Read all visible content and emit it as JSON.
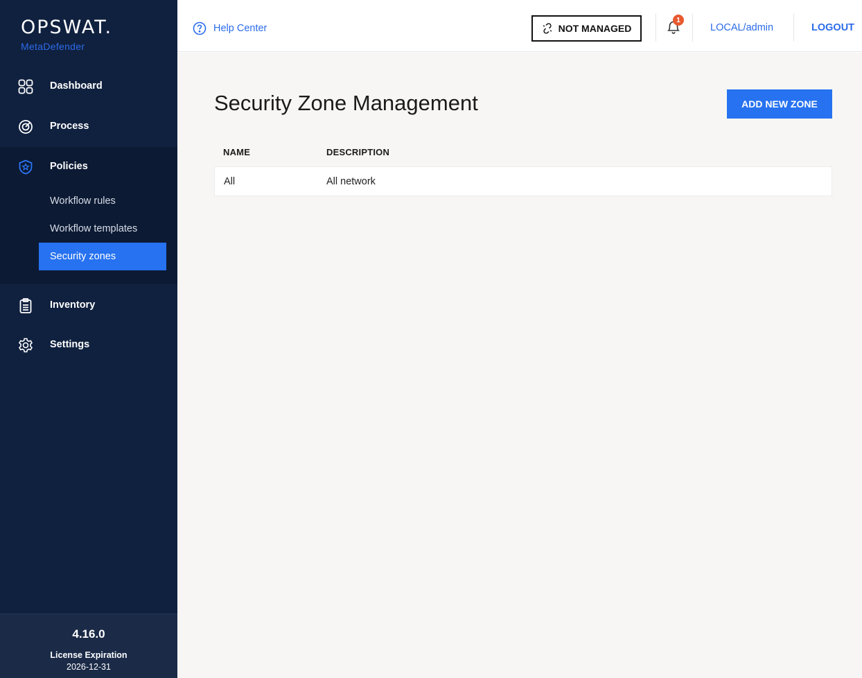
{
  "brand": {
    "name": "OPSWAT.",
    "product": "MetaDefender"
  },
  "sidebar": {
    "items": [
      {
        "label": "Dashboard",
        "icon": "dashboard-grid-icon"
      },
      {
        "label": "Process",
        "icon": "process-target-icon"
      },
      {
        "label": "Policies",
        "icon": "shield-star-icon"
      },
      {
        "label": "Inventory",
        "icon": "clipboard-icon"
      },
      {
        "label": "Settings",
        "icon": "gear-icon"
      }
    ],
    "policies_sub": [
      {
        "label": "Workflow rules",
        "active": false
      },
      {
        "label": "Workflow templates",
        "active": false
      },
      {
        "label": "Security zones",
        "active": true
      }
    ],
    "footer": {
      "version": "4.16.0",
      "license_label": "License Expiration",
      "license_date": "2026-12-31"
    }
  },
  "topbar": {
    "help": "Help Center",
    "status": "NOT MANAGED",
    "notification_count": "1",
    "user": "LOCAL/admin",
    "logout": "LOGOUT"
  },
  "main": {
    "title": "Security Zone Management",
    "add_button": "ADD NEW ZONE",
    "columns": [
      "NAME",
      "DESCRIPTION"
    ],
    "rows": [
      {
        "name": "All",
        "description": "All network"
      }
    ]
  },
  "colors": {
    "sidebar_bg": "#10213f",
    "accent": "#2672f0",
    "badge": "#e8592f",
    "content_bg": "#f7f6f4"
  }
}
